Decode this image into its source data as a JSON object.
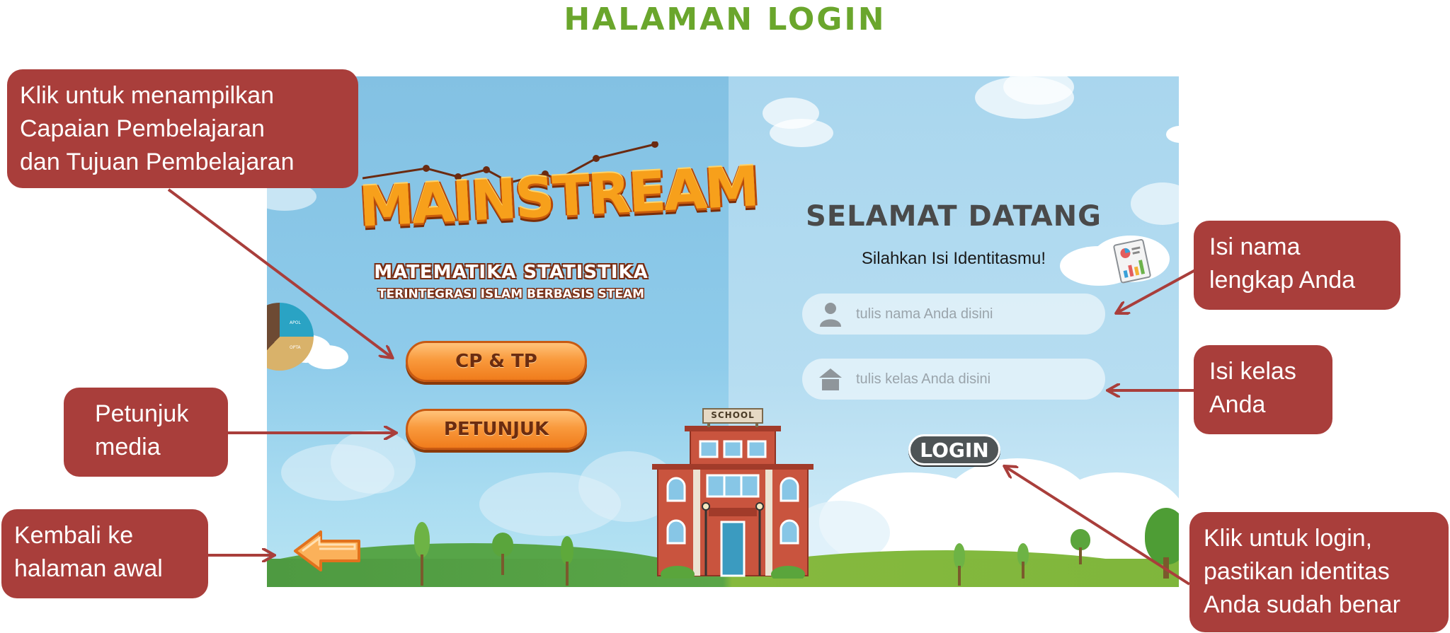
{
  "page": {
    "title": "HALAMAN LOGIN"
  },
  "app": {
    "logo": "MAINSTREAM",
    "subtitle_1": "MATEMATIKA STATISTIKA",
    "subtitle_2": "TERINTEGRASI ISLAM BERBASIS STEAM",
    "buttons": {
      "cp_tp": "CP & TP",
      "petunjuk": "PETUNJUK"
    },
    "school_sign": "SCHOOL",
    "pie_labels": [
      "APOL",
      "OPTA"
    ]
  },
  "login": {
    "title": "SELAMAT DATANG",
    "subtitle": "Silahkan Isi Identitasmu!",
    "name_placeholder": "tulis nama Anda disini",
    "class_placeholder": "tulis kelas Anda disini",
    "button": "LOGIN"
  },
  "callouts": {
    "cp_tp": [
      "Klik untuk menampilkan",
      "Capaian Pembelajaran",
      "dan Tujuan Pembelajaran"
    ],
    "petunjuk": [
      "Petunjuk",
      "media"
    ],
    "back": [
      "Kembali ke",
      "halaman awal"
    ],
    "name": [
      "Isi nama",
      "lengkap Anda"
    ],
    "class": [
      "Isi kelas",
      "Anda"
    ],
    "login": [
      "Klik untuk login,",
      "pastikan identitas",
      "Anda sudah benar"
    ]
  },
  "colors": {
    "title_green": "#6aa62c",
    "callout_red": "#a93e3b",
    "arrow_red": "#a93e3b",
    "button_orange": "#f99a3d"
  },
  "icons": [
    "user-icon",
    "house-icon",
    "back-arrow-icon",
    "chart-line-icon",
    "pie-chart-icon",
    "document-chart-icon"
  ]
}
